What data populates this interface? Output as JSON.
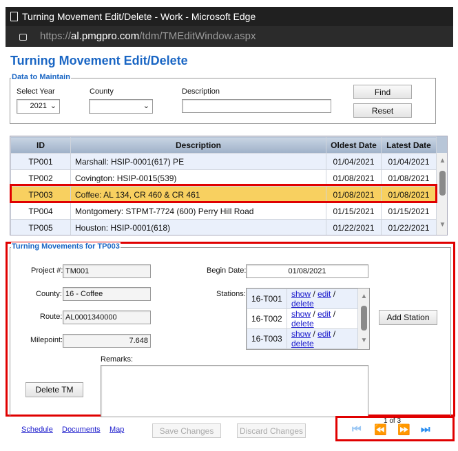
{
  "browser": {
    "title": "Turning Movement Edit/Delete - Work - Microsoft Edge",
    "url_prefix": "https://",
    "url_domain": "al.pmgpro.com",
    "url_path": "/tdm/TMEditWindow.aspx"
  },
  "page_title": "Turning Movement Edit/Delete",
  "filter": {
    "legend": "Data to Maintain",
    "year_label": "Select Year",
    "year_value": "2021",
    "county_label": "County",
    "county_value": "",
    "description_label": "Description",
    "description_value": "",
    "find": "Find",
    "reset": "Reset"
  },
  "grid": {
    "headers": [
      "ID",
      "Description",
      "Oldest Date",
      "Latest Date"
    ],
    "rows": [
      {
        "id": "TP001",
        "description": "Marshall: HSIP-0001(617) PE",
        "oldest": "01/04/2021",
        "latest": "01/04/2021"
      },
      {
        "id": "TP002",
        "description": "Covington: HSIP-0015(539)",
        "oldest": "01/08/2021",
        "latest": "01/08/2021"
      },
      {
        "id": "TP003",
        "description": "Coffee: AL 134, CR 460 & CR 461",
        "oldest": "01/08/2021",
        "latest": "01/08/2021"
      },
      {
        "id": "TP004",
        "description": "Montgomery: STPMT-7724 (600) Perry Hill Road",
        "oldest": "01/15/2021",
        "latest": "01/15/2021"
      },
      {
        "id": "TP005",
        "description": "Houston: HSIP-0001(618)",
        "oldest": "01/22/2021",
        "latest": "01/22/2021"
      }
    ],
    "selected_id": "TP003"
  },
  "detail": {
    "legend": "Turning Movements for TP003",
    "project_label": "Project #:",
    "project": "TM001",
    "county_label": "County:",
    "county": "16 - Coffee",
    "route_label": "Route:",
    "route": "AL0001340000",
    "milepoint_label": "Milepoint:",
    "milepoint": "7.648",
    "begin_label": "Begin Date:",
    "begin": "01/08/2021",
    "stations_label": "Stations:",
    "stations": [
      "16-T001",
      "16-T002",
      "16-T003"
    ],
    "show": "show",
    "edit": "edit",
    "delete": "delete",
    "sep": "/",
    "add_station": "Add Station",
    "remarks_label": "Remarks:",
    "remarks": "",
    "delete_tm": "Delete TM"
  },
  "footer": {
    "schedule": "Schedule",
    "documents": "Documents",
    "map": "Map",
    "save": "Save Changes",
    "discard": "Discard Changes",
    "pager": "1 of 3"
  }
}
